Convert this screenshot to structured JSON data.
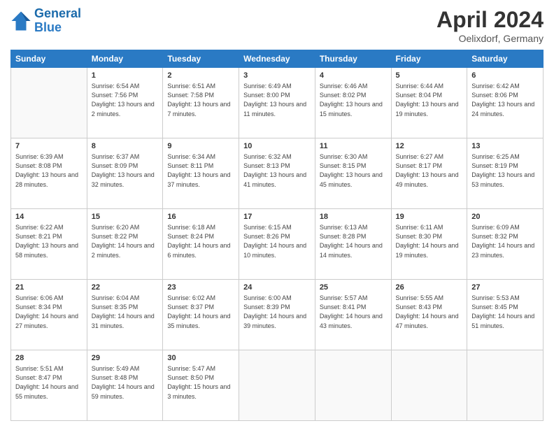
{
  "header": {
    "logo_line1": "General",
    "logo_line2": "Blue",
    "title": "April 2024",
    "location": "Oelixdorf, Germany"
  },
  "weekdays": [
    "Sunday",
    "Monday",
    "Tuesday",
    "Wednesday",
    "Thursday",
    "Friday",
    "Saturday"
  ],
  "weeks": [
    [
      {
        "day": "",
        "sunrise": "",
        "sunset": "",
        "daylight": ""
      },
      {
        "day": "1",
        "sunrise": "Sunrise: 6:54 AM",
        "sunset": "Sunset: 7:56 PM",
        "daylight": "Daylight: 13 hours and 2 minutes."
      },
      {
        "day": "2",
        "sunrise": "Sunrise: 6:51 AM",
        "sunset": "Sunset: 7:58 PM",
        "daylight": "Daylight: 13 hours and 7 minutes."
      },
      {
        "day": "3",
        "sunrise": "Sunrise: 6:49 AM",
        "sunset": "Sunset: 8:00 PM",
        "daylight": "Daylight: 13 hours and 11 minutes."
      },
      {
        "day": "4",
        "sunrise": "Sunrise: 6:46 AM",
        "sunset": "Sunset: 8:02 PM",
        "daylight": "Daylight: 13 hours and 15 minutes."
      },
      {
        "day": "5",
        "sunrise": "Sunrise: 6:44 AM",
        "sunset": "Sunset: 8:04 PM",
        "daylight": "Daylight: 13 hours and 19 minutes."
      },
      {
        "day": "6",
        "sunrise": "Sunrise: 6:42 AM",
        "sunset": "Sunset: 8:06 PM",
        "daylight": "Daylight: 13 hours and 24 minutes."
      }
    ],
    [
      {
        "day": "7",
        "sunrise": "Sunrise: 6:39 AM",
        "sunset": "Sunset: 8:08 PM",
        "daylight": "Daylight: 13 hours and 28 minutes."
      },
      {
        "day": "8",
        "sunrise": "Sunrise: 6:37 AM",
        "sunset": "Sunset: 8:09 PM",
        "daylight": "Daylight: 13 hours and 32 minutes."
      },
      {
        "day": "9",
        "sunrise": "Sunrise: 6:34 AM",
        "sunset": "Sunset: 8:11 PM",
        "daylight": "Daylight: 13 hours and 37 minutes."
      },
      {
        "day": "10",
        "sunrise": "Sunrise: 6:32 AM",
        "sunset": "Sunset: 8:13 PM",
        "daylight": "Daylight: 13 hours and 41 minutes."
      },
      {
        "day": "11",
        "sunrise": "Sunrise: 6:30 AM",
        "sunset": "Sunset: 8:15 PM",
        "daylight": "Daylight: 13 hours and 45 minutes."
      },
      {
        "day": "12",
        "sunrise": "Sunrise: 6:27 AM",
        "sunset": "Sunset: 8:17 PM",
        "daylight": "Daylight: 13 hours and 49 minutes."
      },
      {
        "day": "13",
        "sunrise": "Sunrise: 6:25 AM",
        "sunset": "Sunset: 8:19 PM",
        "daylight": "Daylight: 13 hours and 53 minutes."
      }
    ],
    [
      {
        "day": "14",
        "sunrise": "Sunrise: 6:22 AM",
        "sunset": "Sunset: 8:21 PM",
        "daylight": "Daylight: 13 hours and 58 minutes."
      },
      {
        "day": "15",
        "sunrise": "Sunrise: 6:20 AM",
        "sunset": "Sunset: 8:22 PM",
        "daylight": "Daylight: 14 hours and 2 minutes."
      },
      {
        "day": "16",
        "sunrise": "Sunrise: 6:18 AM",
        "sunset": "Sunset: 8:24 PM",
        "daylight": "Daylight: 14 hours and 6 minutes."
      },
      {
        "day": "17",
        "sunrise": "Sunrise: 6:15 AM",
        "sunset": "Sunset: 8:26 PM",
        "daylight": "Daylight: 14 hours and 10 minutes."
      },
      {
        "day": "18",
        "sunrise": "Sunrise: 6:13 AM",
        "sunset": "Sunset: 8:28 PM",
        "daylight": "Daylight: 14 hours and 14 minutes."
      },
      {
        "day": "19",
        "sunrise": "Sunrise: 6:11 AM",
        "sunset": "Sunset: 8:30 PM",
        "daylight": "Daylight: 14 hours and 19 minutes."
      },
      {
        "day": "20",
        "sunrise": "Sunrise: 6:09 AM",
        "sunset": "Sunset: 8:32 PM",
        "daylight": "Daylight: 14 hours and 23 minutes."
      }
    ],
    [
      {
        "day": "21",
        "sunrise": "Sunrise: 6:06 AM",
        "sunset": "Sunset: 8:34 PM",
        "daylight": "Daylight: 14 hours and 27 minutes."
      },
      {
        "day": "22",
        "sunrise": "Sunrise: 6:04 AM",
        "sunset": "Sunset: 8:35 PM",
        "daylight": "Daylight: 14 hours and 31 minutes."
      },
      {
        "day": "23",
        "sunrise": "Sunrise: 6:02 AM",
        "sunset": "Sunset: 8:37 PM",
        "daylight": "Daylight: 14 hours and 35 minutes."
      },
      {
        "day": "24",
        "sunrise": "Sunrise: 6:00 AM",
        "sunset": "Sunset: 8:39 PM",
        "daylight": "Daylight: 14 hours and 39 minutes."
      },
      {
        "day": "25",
        "sunrise": "Sunrise: 5:57 AM",
        "sunset": "Sunset: 8:41 PM",
        "daylight": "Daylight: 14 hours and 43 minutes."
      },
      {
        "day": "26",
        "sunrise": "Sunrise: 5:55 AM",
        "sunset": "Sunset: 8:43 PM",
        "daylight": "Daylight: 14 hours and 47 minutes."
      },
      {
        "day": "27",
        "sunrise": "Sunrise: 5:53 AM",
        "sunset": "Sunset: 8:45 PM",
        "daylight": "Daylight: 14 hours and 51 minutes."
      }
    ],
    [
      {
        "day": "28",
        "sunrise": "Sunrise: 5:51 AM",
        "sunset": "Sunset: 8:47 PM",
        "daylight": "Daylight: 14 hours and 55 minutes."
      },
      {
        "day": "29",
        "sunrise": "Sunrise: 5:49 AM",
        "sunset": "Sunset: 8:48 PM",
        "daylight": "Daylight: 14 hours and 59 minutes."
      },
      {
        "day": "30",
        "sunrise": "Sunrise: 5:47 AM",
        "sunset": "Sunset: 8:50 PM",
        "daylight": "Daylight: 15 hours and 3 minutes."
      },
      {
        "day": "",
        "sunrise": "",
        "sunset": "",
        "daylight": ""
      },
      {
        "day": "",
        "sunrise": "",
        "sunset": "",
        "daylight": ""
      },
      {
        "day": "",
        "sunrise": "",
        "sunset": "",
        "daylight": ""
      },
      {
        "day": "",
        "sunrise": "",
        "sunset": "",
        "daylight": ""
      }
    ]
  ]
}
